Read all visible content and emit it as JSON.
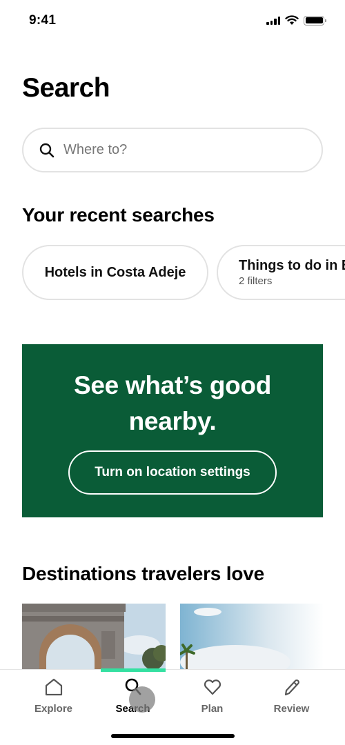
{
  "status_bar": {
    "time": "9:41"
  },
  "page": {
    "title": "Search"
  },
  "search": {
    "placeholder": "Where to?",
    "value": ""
  },
  "recent_searches": {
    "title": "Your recent searches",
    "items": [
      {
        "label": "Hotels in Costa Adeje",
        "subtitle": ""
      },
      {
        "label": "Things to do in B",
        "subtitle": "2 filters"
      }
    ]
  },
  "location_banner": {
    "title_line1": "See what’s good",
    "title_line2": "nearby.",
    "button_label": "Turn on location settings",
    "background_color": "#0a5c37"
  },
  "destinations": {
    "title": "Destinations travelers love",
    "cards": [
      {
        "image": "arch-monument-photo"
      },
      {
        "image": "palm-tree-sky-photo"
      }
    ]
  },
  "tab_bar": {
    "active_tab": "Search",
    "accent_color": "#34e0a1",
    "tabs": [
      {
        "label": "Explore",
        "icon": "home-icon"
      },
      {
        "label": "Search",
        "icon": "search-icon"
      },
      {
        "label": "Plan",
        "icon": "heart-icon"
      },
      {
        "label": "Review",
        "icon": "pencil-icon"
      }
    ]
  }
}
